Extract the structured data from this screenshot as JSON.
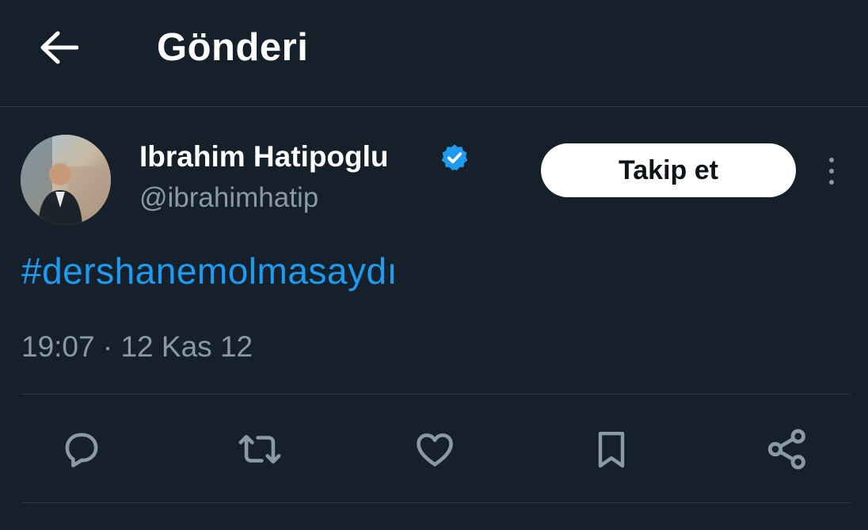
{
  "header": {
    "title": "Gönderi",
    "back_icon": "arrow-left-icon"
  },
  "author": {
    "name": "Ibrahim Hatipoglu",
    "handle": "@ibrahimhatip",
    "verified_icon": "verified-badge-icon",
    "verified_color": "#1d9bf0"
  },
  "follow_button": {
    "label": "Takip et"
  },
  "more_icon": "more-vertical-icon",
  "tweet": {
    "text": "#dershanemolmasaydı",
    "timestamp": "19:07 · 12 Kas 12"
  },
  "actions": [
    {
      "icon": "reply-icon"
    },
    {
      "icon": "retweet-icon"
    },
    {
      "icon": "like-icon"
    },
    {
      "icon": "bookmark-icon"
    },
    {
      "icon": "share-icon"
    }
  ],
  "colors": {
    "background": "#15202b",
    "accent": "#1d9bf0",
    "secondary_text": "#8b98a5",
    "divider": "#2f3b47"
  }
}
